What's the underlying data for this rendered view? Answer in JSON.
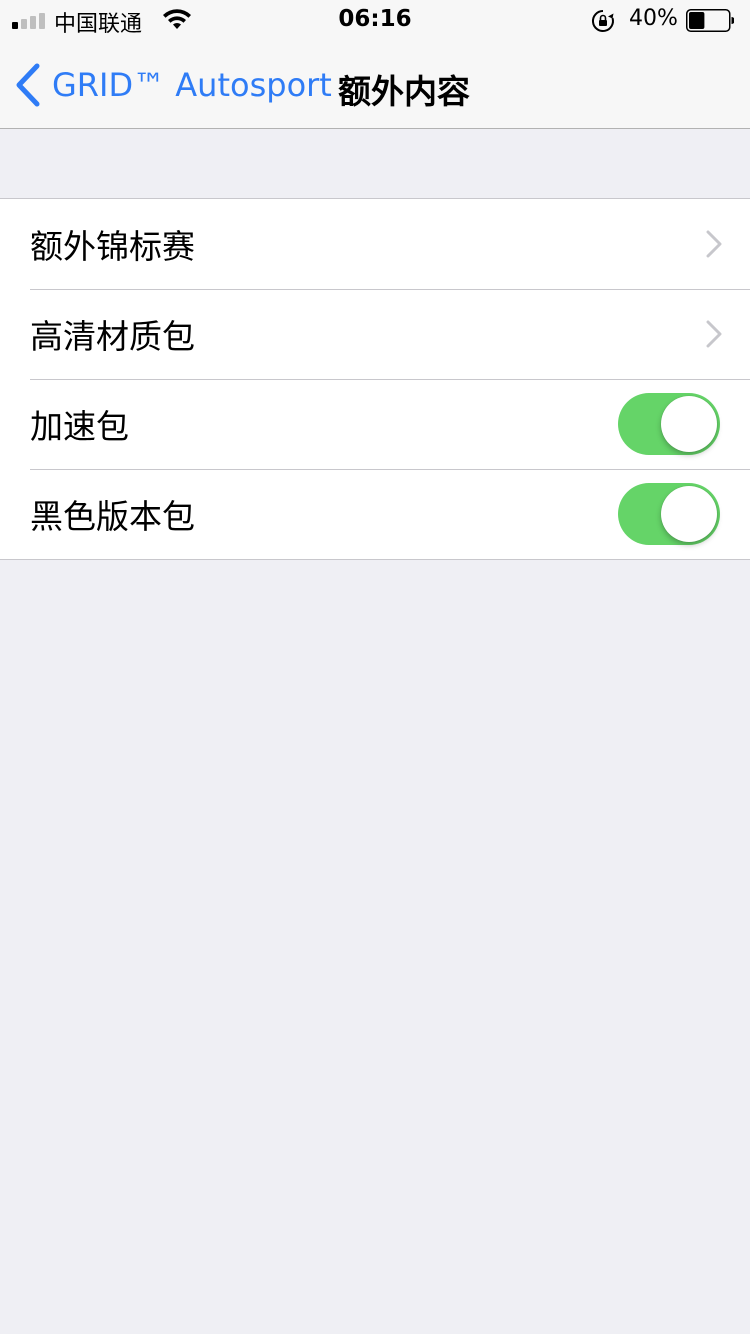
{
  "status_bar": {
    "carrier": "中国联通",
    "time": "06:16",
    "battery_percent": "40%",
    "battery_level": 0.4,
    "signal_bars_on": 1,
    "signal_bars_total": 4
  },
  "nav": {
    "back_label": "GRID™ Autosport",
    "title": "额外内容",
    "accent_color": "#2f7cf6"
  },
  "items": [
    {
      "label": "额外锦标赛",
      "control": "chevron"
    },
    {
      "label": "高清材质包",
      "control": "chevron"
    },
    {
      "label": "加速包",
      "control": "toggle",
      "on": true
    },
    {
      "label": "黑色版本包",
      "control": "toggle",
      "on": true
    }
  ],
  "colors": {
    "toggle_on": "#65d468",
    "background": "#efeff4"
  }
}
